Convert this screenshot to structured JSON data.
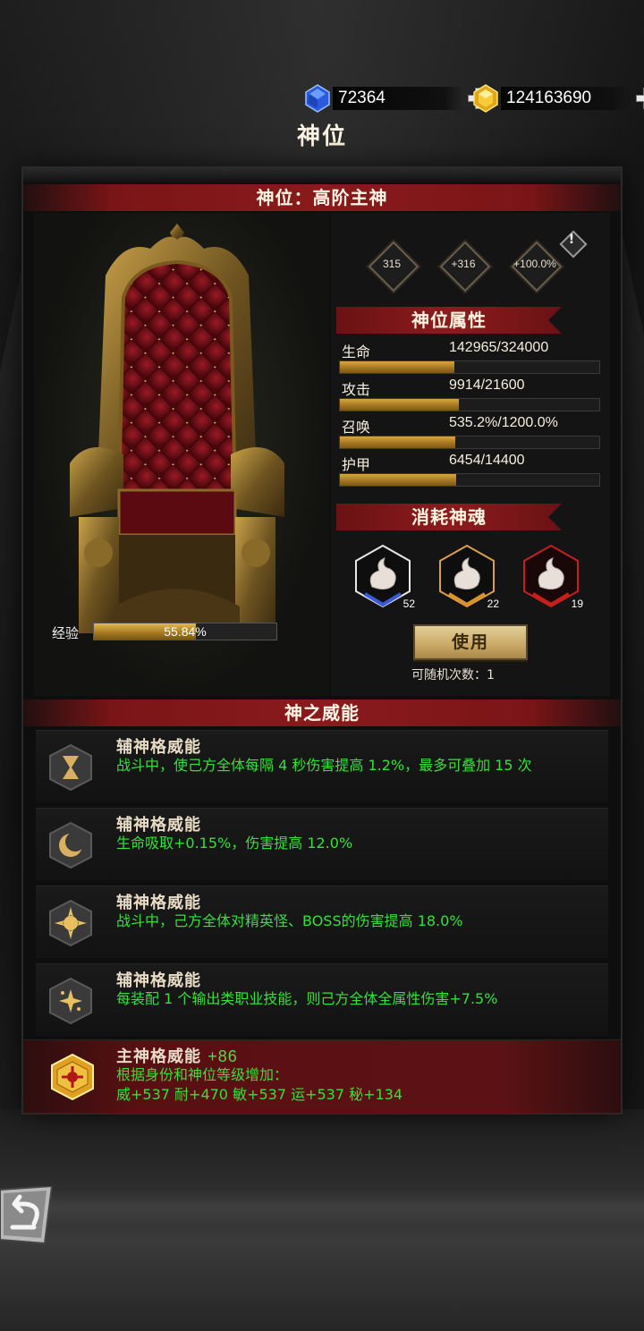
{
  "currency": {
    "gems": "72364",
    "gold": "124163690"
  },
  "page_title": "神位",
  "rank_header": "神位：高阶主神",
  "badges": [
    "315",
    "+316",
    "+100.0%"
  ],
  "attributes": {
    "header": "神位属性",
    "items": [
      {
        "name": "生命",
        "value": "142965/324000",
        "fill": 0.441
      },
      {
        "name": "攻击",
        "value": "9914/21600",
        "fill": 0.459
      },
      {
        "name": "召唤",
        "value": "535.2%/1200.0%",
        "fill": 0.446
      },
      {
        "name": "护甲",
        "value": "6454/14400",
        "fill": 0.448
      }
    ]
  },
  "souls": {
    "header": "消耗神魂",
    "items": [
      {
        "count": "52",
        "border": "#4a6ac8"
      },
      {
        "count": "22",
        "border": "#d8942a"
      },
      {
        "count": "19",
        "border": "#c42020"
      }
    ]
  },
  "use_button": "使用",
  "random_count": "可随机次数：1",
  "experience": {
    "label": "经验",
    "percent_text": "55.84%",
    "fill": 0.5584
  },
  "powers": {
    "header": "神之威能",
    "items": [
      {
        "name": "辅神格威能",
        "icon": "hourglass-icon",
        "desc": "战斗中，使己方全体每隔 4 秒伤害提高 1.2%，最多可叠加 15 次"
      },
      {
        "name": "辅神格威能",
        "icon": "moon-icon",
        "desc": "生命吸取+0.15%，伤害提高 12.0%"
      },
      {
        "name": "辅神格威能",
        "icon": "sun-icon",
        "desc": "战斗中，己方全体对精英怪、BOSS的伤害提高 18.0%"
      },
      {
        "name": "辅神格威能",
        "icon": "sparkle-icon",
        "desc": "每装配 1 个输出类职业技能，则己方全体全属性伤害+7.5%"
      }
    ],
    "main": {
      "name": "主神格威能",
      "bonus": "+86",
      "icon": "emblem-icon",
      "desc_line1": "根据身份和神位等级增加：",
      "desc_line2": "威+537 耐+470 敏+537 运+537 秘+134"
    }
  },
  "colors": {
    "accent_red": "#8a1a1c",
    "gold": "#c9a863",
    "green_text": "#35e03a"
  }
}
